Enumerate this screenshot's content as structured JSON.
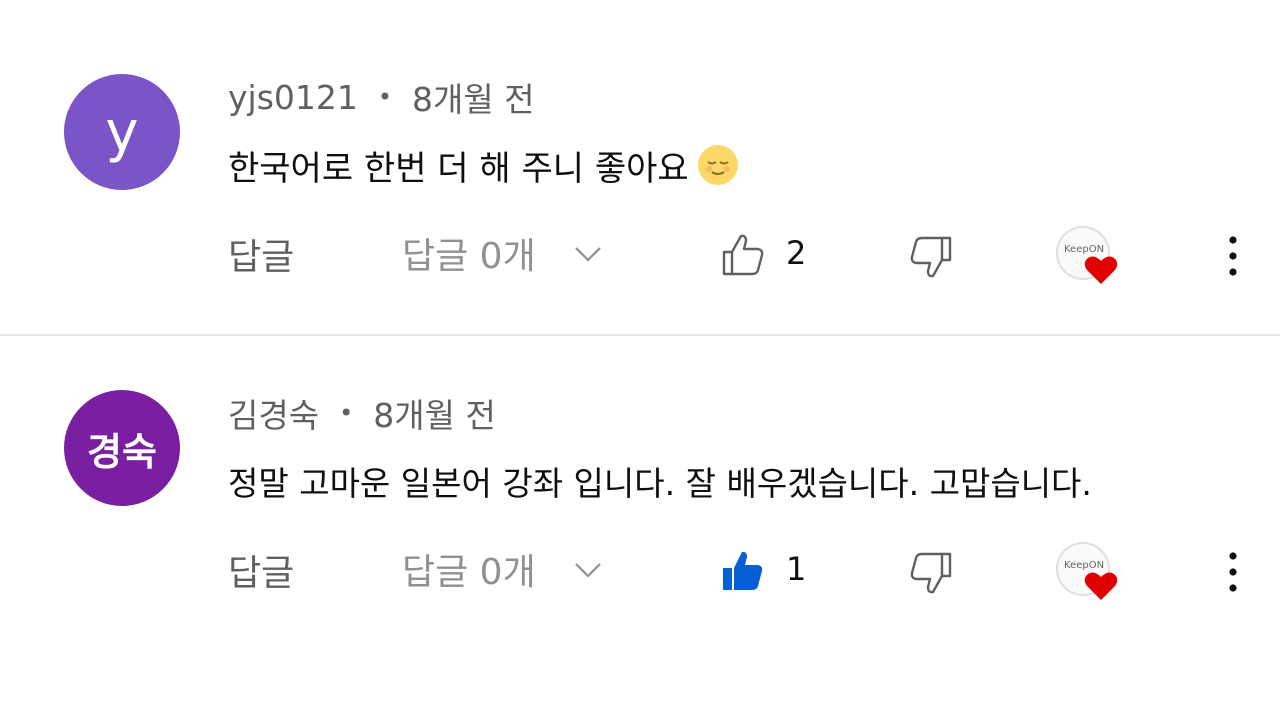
{
  "comments": [
    {
      "avatar_letter": "y",
      "avatar_color": "#7b55c7",
      "author": "yjs0121",
      "time": "8개월 전",
      "text": "한국어로 한번 더 해 주니 좋아요",
      "emoji": "relieved-face-emoji",
      "reply_label": "답글",
      "replies_label": "답글 0개",
      "like_count": "2",
      "liked": false,
      "creator_heart": true
    },
    {
      "avatar_letter": "경숙",
      "avatar_color": "#7b1fa2",
      "author": "김경숙",
      "time": "8개월 전",
      "text": "정말 고마운 일본어 강좌 입니다. 잘 배우겠습니다. 고맙습니다.",
      "reply_label": "답글",
      "replies_label": "답글 0개",
      "like_count": "1",
      "liked": true,
      "creator_heart": true
    }
  ],
  "separator": "•",
  "heart_badge_text": "KeepON",
  "colors": {
    "like_active": "#065fd4",
    "heart": "#e00000",
    "meta_text": "#606060"
  }
}
